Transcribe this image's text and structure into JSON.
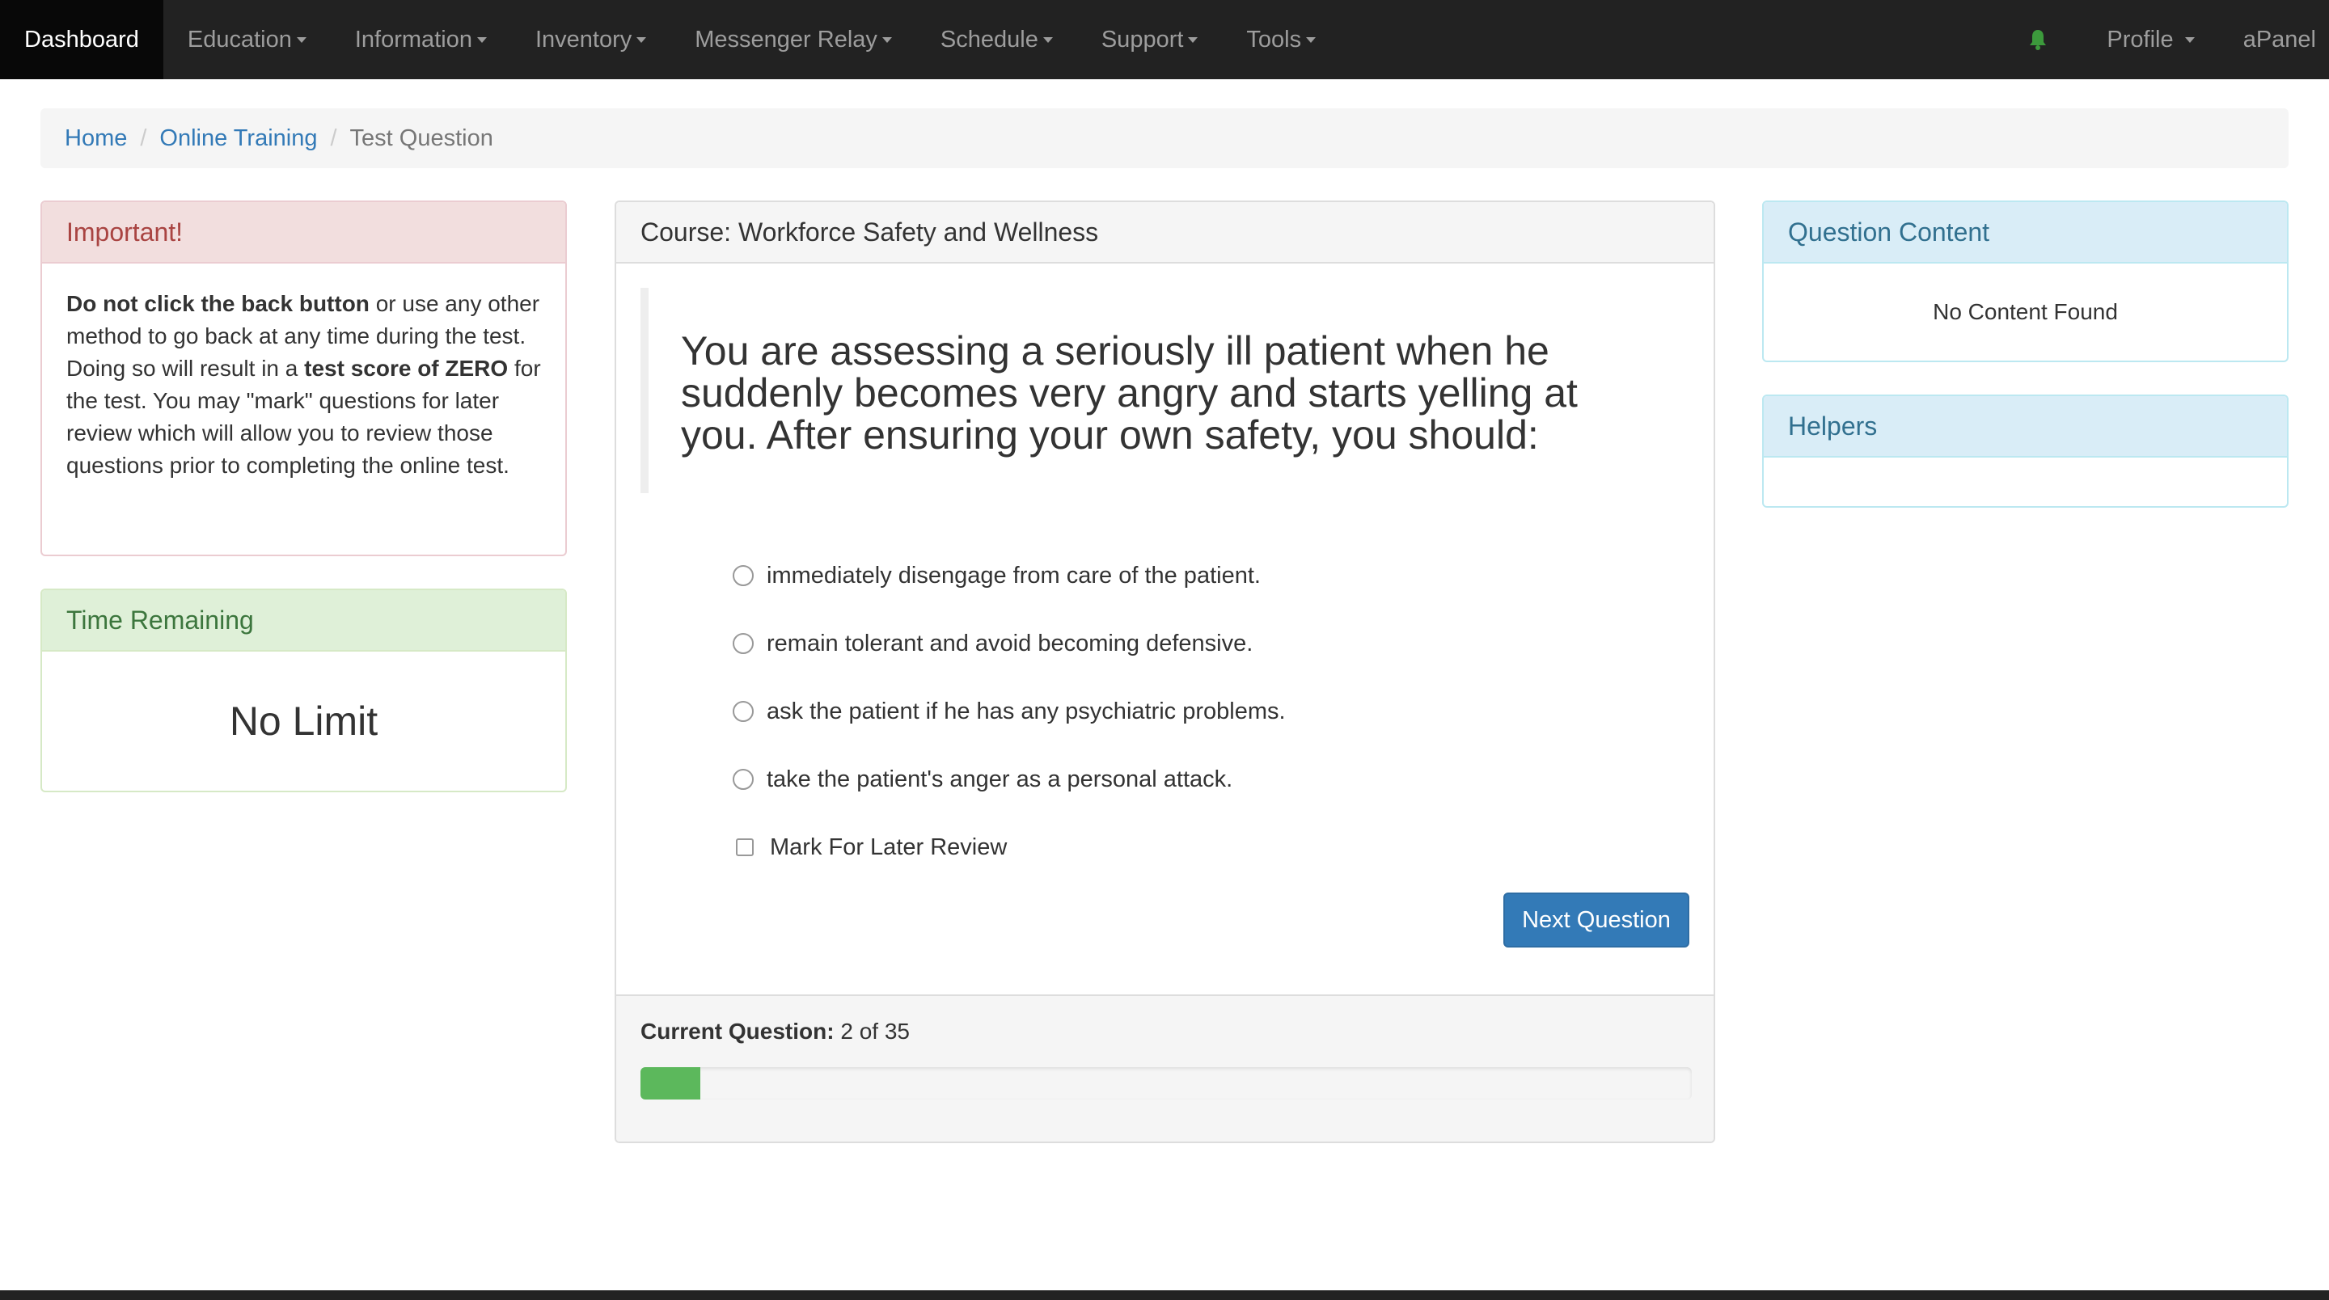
{
  "navbar": {
    "items": [
      {
        "label": "Dashboard"
      },
      {
        "label": "Education"
      },
      {
        "label": "Information"
      },
      {
        "label": "Inventory"
      },
      {
        "label": "Messenger Relay"
      },
      {
        "label": "Schedule"
      },
      {
        "label": "Support"
      },
      {
        "label": "Tools"
      }
    ],
    "profile_label": "Profile",
    "apanel_label": "aPanel",
    "bell_color": "#3c9a3c"
  },
  "breadcrumb": {
    "home": "Home",
    "online_training": "Online Training",
    "current": "Test Question"
  },
  "important": {
    "title": "Important!",
    "bold1": "Do not click the back button",
    "text1": " or use any other method to go back at any time during the test. Doing so will result in a ",
    "bold2": "test score of ZERO",
    "text2": " for the test. You may \"mark\" questions for later review which will allow you to review those questions prior to completing the online test."
  },
  "time": {
    "title": "Time Remaining",
    "value": "No Limit"
  },
  "question": {
    "course_title": "Course: Workforce Safety and Wellness",
    "text": "You are assessing a seriously ill patient when he suddenly becomes very angry and starts yelling at you. After ensuring your own safety, you should:",
    "answers": [
      {
        "label": "immediately disengage from care of the patient."
      },
      {
        "label": "remain tolerant and avoid becoming defensive."
      },
      {
        "label": "ask the patient if he has any psychiatric problems."
      },
      {
        "label": "take the patient's anger as a personal attack."
      }
    ],
    "mark_label": "Mark For Later Review",
    "next_label": "Next Question",
    "current_label": "Current Question:",
    "current_value": "2 of 35",
    "progress_fraction": 0.057
  },
  "question_content": {
    "title": "Question Content",
    "body": "No Content Found"
  },
  "helpers": {
    "title": "Helpers"
  },
  "colors": {
    "navbar_bg": "#222222",
    "link": "#337ab7",
    "primary_button": "#337ab7",
    "progress": "#5cb85c"
  }
}
